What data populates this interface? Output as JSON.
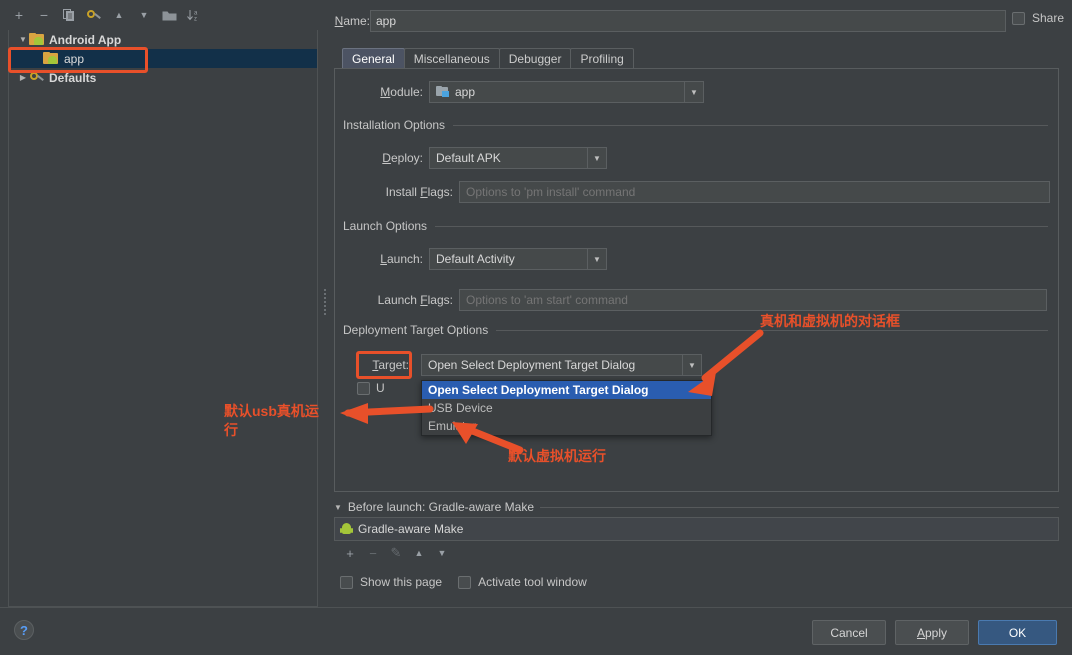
{
  "tree_toolbar": {
    "buttons": [
      {
        "name": "add",
        "glyph": "+"
      },
      {
        "name": "remove",
        "glyph": "−"
      },
      {
        "name": "copy",
        "glyph": "⧉"
      },
      {
        "name": "edit-templates",
        "glyph": "⚒"
      },
      {
        "name": "move-up",
        "glyph": "▲"
      },
      {
        "name": "move-down",
        "glyph": "▼"
      },
      {
        "name": "folder",
        "glyph": "▬"
      },
      {
        "name": "sort-alphabetically",
        "glyph": "↓a₃"
      }
    ]
  },
  "tree": {
    "nodes": [
      {
        "label": "Android App",
        "expanded": true,
        "arrow": "▼",
        "selected": false,
        "child": false
      },
      {
        "label": "app",
        "expanded": false,
        "arrow": "",
        "selected": true,
        "child": true
      },
      {
        "label": "Defaults",
        "expanded": false,
        "arrow": "▶",
        "selected": false,
        "child": false
      }
    ]
  },
  "header": {
    "name_label": "Name:",
    "name_label_mnemonic": "N",
    "name_value": "app",
    "share_label": "Share",
    "share_checked": false
  },
  "tabs": [
    {
      "label": "General",
      "active": true
    },
    {
      "label": "Miscellaneous",
      "active": false
    },
    {
      "label": "Debugger",
      "active": false
    },
    {
      "label": "Profiling",
      "active": false
    }
  ],
  "general": {
    "module_label": "Module:",
    "module_value": "app",
    "installation_section": "Installation Options",
    "deploy_label": "Deploy:",
    "deploy_value": "Default APK",
    "install_flags_label": "Install Flags:",
    "install_flags_placeholder": "Options to 'pm install' command",
    "launch_section": "Launch Options",
    "launch_label": "Launch:",
    "launch_value": "Default Activity",
    "launch_flags_label": "Launch Flags:",
    "launch_flags_placeholder": "Options to 'am start' command",
    "deployment_section": "Deployment Target Options",
    "target_label": "Target:",
    "target_value": "Open Select Deployment Target Dialog",
    "target_options": [
      {
        "label": "Open Select Deployment Target Dialog",
        "selected": true
      },
      {
        "label": "USB Device",
        "selected": false
      },
      {
        "label": "Emulator",
        "selected": false
      }
    ],
    "use_same_device_label": "U",
    "use_same_device_checked": false
  },
  "before_launch": {
    "title": "Before launch: Gradle-aware Make",
    "collapse_arrow": "▼",
    "items": [
      {
        "label": "Gradle-aware Make",
        "icon": "android-robot-icon"
      }
    ],
    "toolbar": [
      {
        "name": "add",
        "glyph": "+",
        "enabled": true
      },
      {
        "name": "remove",
        "glyph": "−",
        "enabled": false
      },
      {
        "name": "edit",
        "glyph": "✎",
        "enabled": false
      },
      {
        "name": "move-up",
        "glyph": "▲",
        "enabled": true
      },
      {
        "name": "move-down",
        "glyph": "▼",
        "enabled": true
      }
    ],
    "show_this_page_label": "Show this page",
    "show_this_page_checked": false,
    "activate_tool_window_label": "Activate tool window",
    "activate_tool_window_checked": false
  },
  "footer": {
    "help_glyph": "?",
    "cancel_label": "Cancel",
    "apply_label": "Apply",
    "apply_mnemonic": "A",
    "ok_label": "OK"
  },
  "annotations": {
    "color": "#e8502a",
    "dialog_note": "真机和虚拟机的对话框",
    "usb_note": "默认usb真机运\n行",
    "emulator_note": "默认虚拟机运行"
  },
  "colors": {
    "panel_bg": "#3c4043",
    "accent_blue": "#2a5db0",
    "primary_button": "#365880",
    "selection_navy": "#123049",
    "annotation_orange": "#e8502a"
  }
}
